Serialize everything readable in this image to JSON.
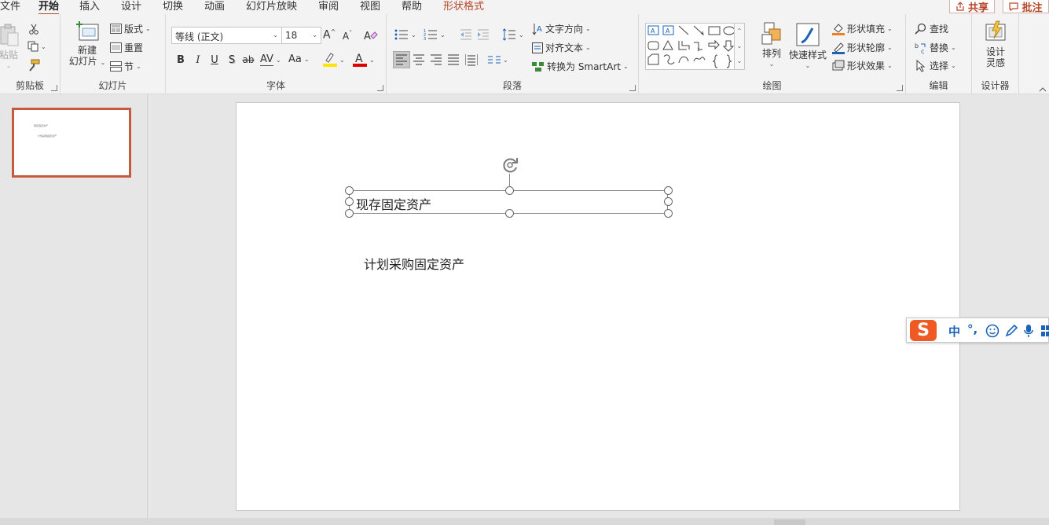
{
  "menu": {
    "tabs": [
      "文件",
      "开始",
      "插入",
      "设计",
      "切换",
      "动画",
      "幻灯片放映",
      "审阅",
      "视图",
      "帮助",
      "形状格式"
    ],
    "share_label": "共享",
    "comment_label": "批注"
  },
  "ribbon": {
    "clipboard": {
      "label": "剪贴板",
      "paste_label": "粘贴"
    },
    "slides": {
      "label": "幻灯片",
      "new_slide_line1": "新建",
      "new_slide_line2": "幻灯片",
      "layout_label": "版式",
      "reset_label": "重置",
      "section_label": "节"
    },
    "font": {
      "label": "字体",
      "font_name": "等线 (正文)",
      "font_size": "18",
      "grow": "A",
      "shrink": "A",
      "bold": "B",
      "italic": "I",
      "underline": "U",
      "shadow": "S",
      "strike": "ab",
      "spacing": "AV",
      "case": "Aa",
      "color_letter": "A"
    },
    "paragraph": {
      "label": "段落",
      "text_direction": "文字方向",
      "align_text": "对齐文本",
      "convert_smartart": "转换为 SmartArt"
    },
    "drawing": {
      "label": "绘图",
      "arrange": "排列",
      "quick_styles": "快速样式",
      "shape_fill": "形状填充",
      "shape_outline": "形状轮廓",
      "shape_effects": "形状效果"
    },
    "editing": {
      "label": "编辑",
      "find": "查找",
      "replace": "替换",
      "select": "选择"
    },
    "designer": {
      "label": "设计器",
      "ideas_line1": "设计",
      "ideas_line2": "灵感"
    }
  },
  "thumbnail": {
    "line1": "现存固定资产",
    "line2": "计划采购固定资产"
  },
  "slide": {
    "textbox1": "现存固定资产",
    "textbox2": "计划采购固定资产"
  },
  "ime": {
    "logo": "S",
    "mode": "中",
    "punct": "°,"
  },
  "colors": {
    "accent": "#b7472a",
    "highlight": "#ffe500",
    "font_color": "#e00000",
    "ime_orange": "#ef5a24",
    "ime_blue": "#1a63b6"
  }
}
